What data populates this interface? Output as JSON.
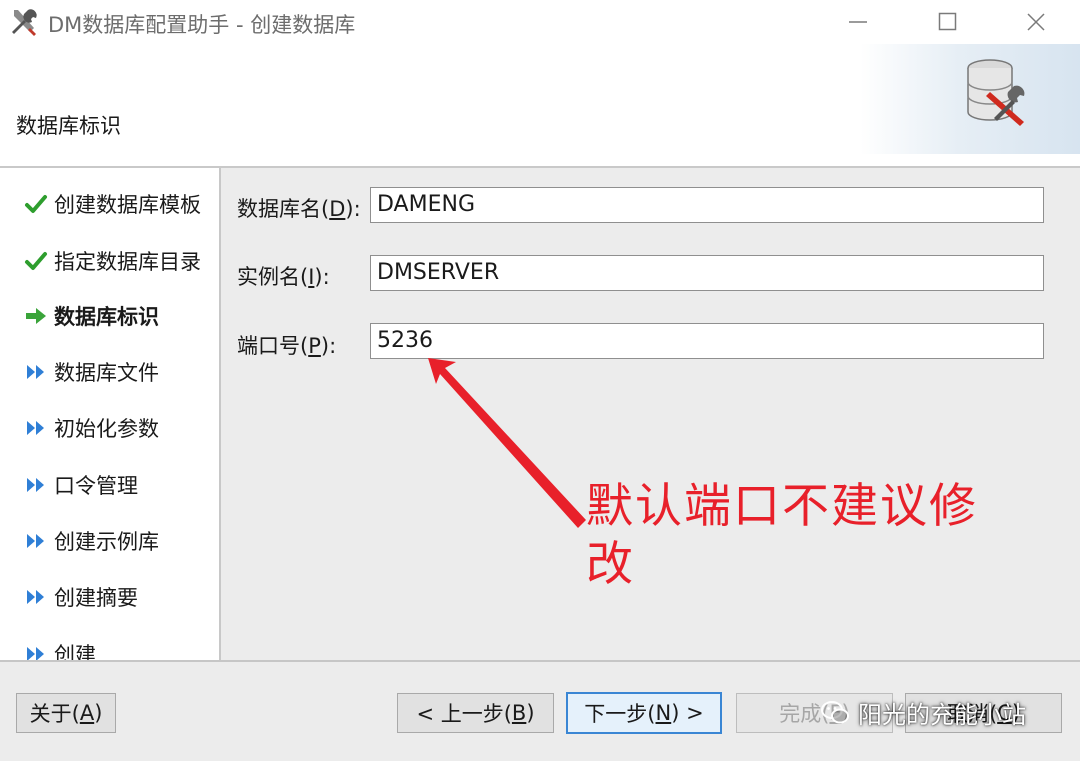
{
  "window": {
    "title": "DM数据库配置助手 - 创建数据库"
  },
  "header": {
    "title": "数据库标识"
  },
  "nav": {
    "items": [
      {
        "label": "创建数据库模板",
        "status": "done",
        "icon": "check-icon"
      },
      {
        "label": "指定数据库目录",
        "status": "done",
        "icon": "check-icon"
      },
      {
        "label": "数据库标识",
        "status": "current",
        "icon": "arrow-right-icon"
      },
      {
        "label": "数据库文件",
        "status": "pending",
        "icon": "double-chevron-icon"
      },
      {
        "label": "初始化参数",
        "status": "pending",
        "icon": "double-chevron-icon"
      },
      {
        "label": "口令管理",
        "status": "pending",
        "icon": "double-chevron-icon"
      },
      {
        "label": "创建示例库",
        "status": "pending",
        "icon": "double-chevron-icon"
      },
      {
        "label": "创建摘要",
        "status": "pending",
        "icon": "double-chevron-icon"
      },
      {
        "label": "创建",
        "status": "pending",
        "icon": "double-chevron-icon"
      }
    ]
  },
  "form": {
    "db_name": {
      "label_pre": "数据库名(",
      "mnemonic": "D",
      "label_post": "):",
      "value": "DAMENG"
    },
    "instance": {
      "label_pre": "实例名(",
      "mnemonic": "I",
      "label_post": "):",
      "value": "DMSERVER"
    },
    "port": {
      "label_pre": "端口号(",
      "mnemonic": "P",
      "label_post": "):",
      "value": "5236"
    }
  },
  "annotation": {
    "text": "默认端口不建议修改",
    "color": "#e8202a"
  },
  "footer": {
    "about": {
      "pre": "关于(",
      "key": "A",
      "post": ")"
    },
    "prev": {
      "pre": "< 上一步(",
      "key": "B",
      "post": ")"
    },
    "next": {
      "pre": "下一步(",
      "key": "N",
      "post": ") >"
    },
    "finish": {
      "pre": "完成(",
      "key": "F",
      "post": ")"
    },
    "cancel": {
      "pre": "取消(",
      "key": "C",
      "post": ")"
    }
  },
  "watermark": {
    "text": "阳光的充能小站",
    "icon": "wechat-icon"
  },
  "colors": {
    "accent": "#3a86d4",
    "check": "#2e9e2e",
    "current_arrow": "#3aa43a",
    "pending_chevron": "#2f7fd6"
  }
}
